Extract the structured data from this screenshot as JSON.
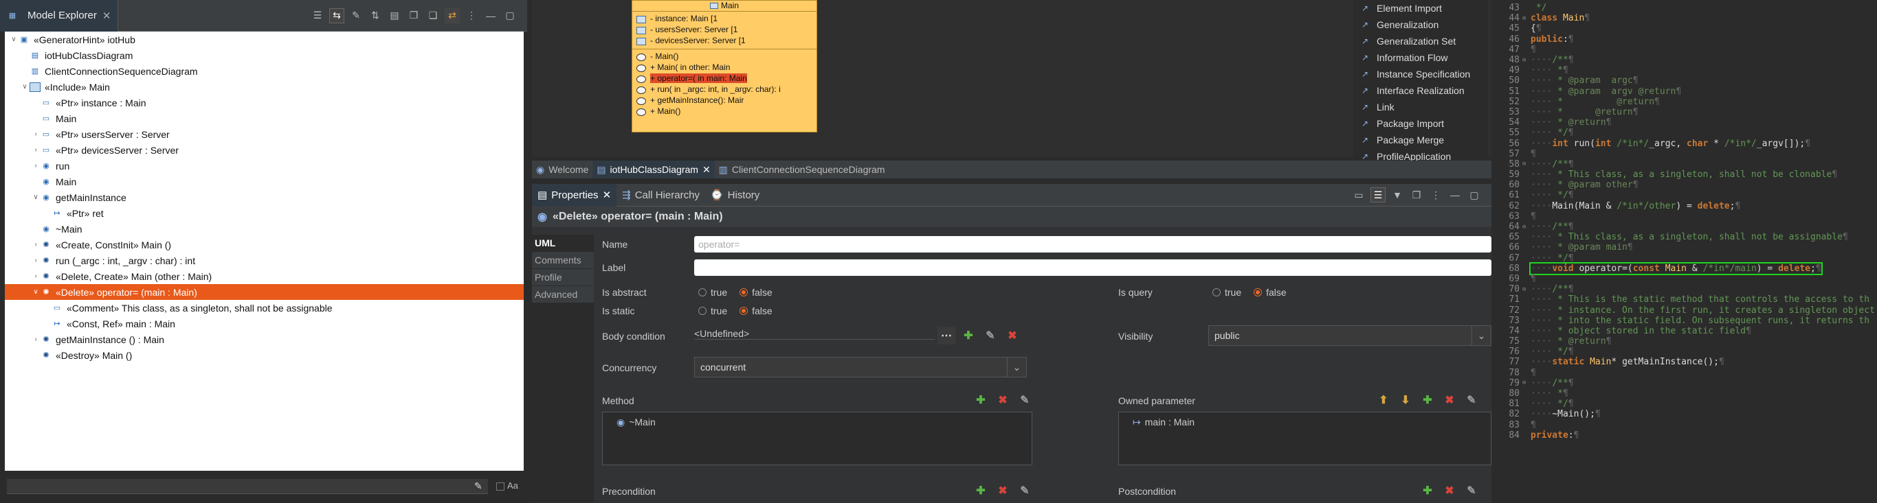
{
  "explorer": {
    "title": "Model Explorer",
    "aa": "Aa",
    "items": [
      {
        "label": "«GeneratorHint» iotHub",
        "indent": 0,
        "tw": "∨",
        "icon": "pkg"
      },
      {
        "label": "iotHubClassDiagram",
        "indent": 1,
        "tw": "",
        "icon": "diag"
      },
      {
        "label": "ClientConnectionSequenceDiagram",
        "indent": 1,
        "tw": "",
        "icon": "seq"
      },
      {
        "label": "«Include» Main",
        "indent": 1,
        "tw": "∨",
        "icon": "cls"
      },
      {
        "label": "«Ptr» instance : Main",
        "indent": 2,
        "tw": "",
        "icon": "attr"
      },
      {
        "label": "Main",
        "indent": 2,
        "tw": "",
        "icon": "attr"
      },
      {
        "label": "«Ptr» usersServer : Server",
        "indent": 2,
        "tw": "›",
        "icon": "attr"
      },
      {
        "label": "«Ptr» devicesServer : Server",
        "indent": 2,
        "tw": "›",
        "icon": "attr"
      },
      {
        "label": "run",
        "indent": 2,
        "tw": "›",
        "icon": "op"
      },
      {
        "label": "Main",
        "indent": 2,
        "tw": "",
        "icon": "op"
      },
      {
        "label": "getMainInstance",
        "indent": 2,
        "tw": "∨",
        "icon": "op"
      },
      {
        "label": "«Ptr» ret",
        "indent": 3,
        "tw": "",
        "icon": "param"
      },
      {
        "label": "~Main",
        "indent": 2,
        "tw": "",
        "icon": "op"
      },
      {
        "label": "«Create, ConstInit» Main ()",
        "indent": 2,
        "tw": "›",
        "icon": "gear"
      },
      {
        "label": "run (_argc : int, _argv : char) : int",
        "indent": 2,
        "tw": "›",
        "icon": "gear"
      },
      {
        "label": "«Delete, Create» Main (other : Main)",
        "indent": 2,
        "tw": "›",
        "icon": "gear"
      },
      {
        "label": "«Delete» operator= (main : Main)",
        "indent": 2,
        "tw": "∨",
        "icon": "gear",
        "selected": true
      },
      {
        "label": "«Comment» This class, as a singleton, shall not be assignable",
        "indent": 3,
        "tw": "",
        "icon": "note"
      },
      {
        "label": "«Const, Ref» main : Main",
        "indent": 3,
        "tw": "",
        "icon": "param"
      },
      {
        "label": "getMainInstance () : Main",
        "indent": 2,
        "tw": "›",
        "icon": "gear"
      },
      {
        "label": "«Destroy» Main ()",
        "indent": 2,
        "tw": "",
        "icon": "gear"
      }
    ]
  },
  "uml": {
    "title": "Main",
    "attrs": [
      "- instance: Main [1",
      "- usersServer: Server [1",
      "- devicesServer: Server [1"
    ],
    "ops": [
      "- Main()",
      "+ Main(  in other: Main",
      "+ operator=(  in main: Main",
      "+ run(  in _argc: int,  in _argv: char): i",
      "+ getMainInstance(): Mair",
      "+ Main()"
    ]
  },
  "palette": [
    "Element Import",
    "Generalization",
    "Generalization Set",
    "Information Flow",
    "Instance Specification",
    "Interface Realization",
    "Link",
    "Package Import",
    "Package Merge",
    "ProfileApplication"
  ],
  "editor_tabs": [
    "Welcome",
    "iotHubClassDiagram",
    "ClientConnectionSequenceDiagram"
  ],
  "props": {
    "tabs": [
      "Properties",
      "Call Hierarchy",
      "History"
    ],
    "title": "«Delete» operator= (main : Main)",
    "vtabs": [
      "UML",
      "Comments",
      "Profile",
      "Advanced"
    ],
    "name_label": "Name",
    "name_placeholder": "operator=",
    "label_label": "Label",
    "is_abstract": "Is abstract",
    "is_static": "Is static",
    "is_query": "Is query",
    "true": "true",
    "false": "false",
    "body_condition": "Body condition",
    "body_value": "<Undefined>",
    "visibility": "Visibility",
    "visibility_value": "public",
    "concurrency": "Concurrency",
    "concurrency_value": "concurrent",
    "method": "Method",
    "method_item": "~Main",
    "owned_parameter": "Owned parameter",
    "param_item": "main : Main",
    "precondition": "Precondition",
    "postcondition": "Postcondition"
  },
  "code": {
    "lines": [
      {
        "n": "43",
        "m": "",
        "t": [
          {
            "c": "cm",
            "s": " */"
          }
        ]
      },
      {
        "n": "44",
        "m": "⊖",
        "t": [
          {
            "c": "kw",
            "s": "class "
          },
          {
            "c": "fn",
            "s": "Main"
          },
          {
            "c": "gray",
            "s": "¶"
          }
        ]
      },
      {
        "n": "45",
        "m": "",
        "t": [
          {
            "c": "code",
            "s": "{"
          },
          {
            "c": "gray",
            "s": "¶"
          }
        ]
      },
      {
        "n": "46",
        "m": "",
        "t": [
          {
            "c": "kw",
            "s": "public"
          },
          {
            "c": "code",
            "s": ":"
          },
          {
            "c": "gray",
            "s": "¶"
          }
        ]
      },
      {
        "n": "47",
        "m": "",
        "t": [
          {
            "c": "gray",
            "s": "¶"
          }
        ]
      },
      {
        "n": "48",
        "m": "⊖",
        "t": [
          {
            "c": "gray",
            "s": "····"
          },
          {
            "c": "cm",
            "s": "/**"
          },
          {
            "c": "gray",
            "s": "¶"
          }
        ]
      },
      {
        "n": "49",
        "m": "",
        "t": [
          {
            "c": "gray",
            "s": "····"
          },
          {
            "c": "cm",
            "s": " *"
          },
          {
            "c": "gray",
            "s": "¶"
          }
        ]
      },
      {
        "n": "50",
        "m": "",
        "t": [
          {
            "c": "gray",
            "s": "····"
          },
          {
            "c": "cm",
            "s": " * "
          },
          {
            "c": "jd",
            "s": "@param  argc"
          },
          {
            "c": "gray",
            "s": "¶"
          }
        ]
      },
      {
        "n": "51",
        "m": "",
        "t": [
          {
            "c": "gray",
            "s": "····"
          },
          {
            "c": "cm",
            "s": " * "
          },
          {
            "c": "jd",
            "s": "@param  argv @return"
          },
          {
            "c": "gray",
            "s": "¶"
          }
        ]
      },
      {
        "n": "52",
        "m": "",
        "t": [
          {
            "c": "gray",
            "s": "····"
          },
          {
            "c": "cm",
            "s": " *          "
          },
          {
            "c": "jd",
            "s": "@return"
          },
          {
            "c": "gray",
            "s": "¶"
          }
        ]
      },
      {
        "n": "53",
        "m": "",
        "t": [
          {
            "c": "gray",
            "s": "····"
          },
          {
            "c": "cm",
            "s": " *      "
          },
          {
            "c": "jd",
            "s": "@return"
          },
          {
            "c": "gray",
            "s": "¶"
          }
        ]
      },
      {
        "n": "54",
        "m": "",
        "t": [
          {
            "c": "gray",
            "s": "····"
          },
          {
            "c": "cm",
            "s": " * "
          },
          {
            "c": "jd",
            "s": "@return"
          },
          {
            "c": "gray",
            "s": "¶"
          }
        ]
      },
      {
        "n": "55",
        "m": "",
        "t": [
          {
            "c": "gray",
            "s": "····"
          },
          {
            "c": "cm",
            "s": " */"
          },
          {
            "c": "gray",
            "s": "¶"
          }
        ]
      },
      {
        "n": "56",
        "m": "",
        "t": [
          {
            "c": "gray",
            "s": "····"
          },
          {
            "c": "kw",
            "s": "int "
          },
          {
            "c": "code",
            "s": "run("
          },
          {
            "c": "kw",
            "s": "int "
          },
          {
            "c": "cm",
            "s": "/*in*/"
          },
          {
            "c": "code",
            "s": "_argc, "
          },
          {
            "c": "kw",
            "s": "char "
          },
          {
            "c": "code",
            "s": "* "
          },
          {
            "c": "cm",
            "s": "/*in*/"
          },
          {
            "c": "code",
            "s": "_argv[]);"
          },
          {
            "c": "gray",
            "s": "¶"
          }
        ]
      },
      {
        "n": "57",
        "m": "",
        "t": [
          {
            "c": "gray",
            "s": "¶"
          }
        ]
      },
      {
        "n": "58",
        "m": "⊖",
        "t": [
          {
            "c": "gray",
            "s": "····"
          },
          {
            "c": "cm",
            "s": "/**"
          },
          {
            "c": "gray",
            "s": "¶"
          }
        ]
      },
      {
        "n": "59",
        "m": "",
        "t": [
          {
            "c": "gray",
            "s": "····"
          },
          {
            "c": "cm",
            "s": " * This class, as a singleton, shall not be clonable"
          },
          {
            "c": "gray",
            "s": "¶"
          }
        ]
      },
      {
        "n": "60",
        "m": "",
        "t": [
          {
            "c": "gray",
            "s": "····"
          },
          {
            "c": "cm",
            "s": " * "
          },
          {
            "c": "jd",
            "s": "@param other"
          },
          {
            "c": "gray",
            "s": "¶"
          }
        ]
      },
      {
        "n": "61",
        "m": "",
        "t": [
          {
            "c": "gray",
            "s": "····"
          },
          {
            "c": "cm",
            "s": " */"
          },
          {
            "c": "gray",
            "s": "¶"
          }
        ]
      },
      {
        "n": "62",
        "m": "",
        "t": [
          {
            "c": "gray",
            "s": "····"
          },
          {
            "c": "code",
            "s": "Main(Main & "
          },
          {
            "c": "cm",
            "s": "/*in*/other"
          },
          {
            "c": "code",
            "s": ") = "
          },
          {
            "c": "kw",
            "s": "delete"
          },
          {
            "c": "code",
            "s": ";"
          },
          {
            "c": "gray",
            "s": "¶"
          }
        ]
      },
      {
        "n": "63",
        "m": "",
        "t": [
          {
            "c": "gray",
            "s": "¶"
          }
        ]
      },
      {
        "n": "64",
        "m": "⊖",
        "t": [
          {
            "c": "gray",
            "s": "····"
          },
          {
            "c": "cm",
            "s": "/**"
          },
          {
            "c": "gray",
            "s": "¶"
          }
        ]
      },
      {
        "n": "65",
        "m": "",
        "t": [
          {
            "c": "gray",
            "s": "····"
          },
          {
            "c": "cm",
            "s": " * This class, as a singleton, shall not be assignable"
          },
          {
            "c": "gray",
            "s": "¶"
          }
        ]
      },
      {
        "n": "66",
        "m": "",
        "t": [
          {
            "c": "gray",
            "s": "····"
          },
          {
            "c": "cm",
            "s": " * "
          },
          {
            "c": "jd",
            "s": "@param main"
          },
          {
            "c": "gray",
            "s": "¶"
          }
        ]
      },
      {
        "n": "67",
        "m": "",
        "t": [
          {
            "c": "gray",
            "s": "····"
          },
          {
            "c": "cm",
            "s": " */"
          },
          {
            "c": "gray",
            "s": "¶"
          }
        ]
      },
      {
        "n": "68",
        "m": "",
        "box": true,
        "t": [
          {
            "c": "gray",
            "s": "····"
          },
          {
            "c": "kw",
            "s": "void "
          },
          {
            "c": "code",
            "s": "operator=("
          },
          {
            "c": "kw",
            "s": "const "
          },
          {
            "c": "fn",
            "s": "Main"
          },
          {
            "c": "code",
            "s": " & "
          },
          {
            "c": "cm",
            "s": "/*in*/main"
          },
          {
            "c": "code",
            "s": ") = "
          },
          {
            "c": "kw",
            "s": "delete"
          },
          {
            "c": "code",
            "s": ";"
          },
          {
            "c": "gray",
            "s": "¶"
          }
        ]
      },
      {
        "n": "69",
        "m": "",
        "t": [
          {
            "c": "gray",
            "s": "¶"
          }
        ]
      },
      {
        "n": "70",
        "m": "⊖",
        "t": [
          {
            "c": "gray",
            "s": "····"
          },
          {
            "c": "cm",
            "s": "/**"
          },
          {
            "c": "gray",
            "s": "¶"
          }
        ]
      },
      {
        "n": "71",
        "m": "",
        "t": [
          {
            "c": "gray",
            "s": "····"
          },
          {
            "c": "cm",
            "s": " * This is the static method that controls the access to th"
          }
        ]
      },
      {
        "n": "72",
        "m": "",
        "t": [
          {
            "c": "gray",
            "s": "····"
          },
          {
            "c": "cm",
            "s": " * instance. On the first run, it creates a singleton object"
          }
        ]
      },
      {
        "n": "73",
        "m": "",
        "t": [
          {
            "c": "gray",
            "s": "····"
          },
          {
            "c": "cm",
            "s": " * into the static field. On subsequent runs, it returns th"
          }
        ]
      },
      {
        "n": "74",
        "m": "",
        "t": [
          {
            "c": "gray",
            "s": "····"
          },
          {
            "c": "cm",
            "s": " * object stored in the static field"
          },
          {
            "c": "gray",
            "s": "¶"
          }
        ]
      },
      {
        "n": "75",
        "m": "",
        "t": [
          {
            "c": "gray",
            "s": "····"
          },
          {
            "c": "cm",
            "s": " * "
          },
          {
            "c": "jd",
            "s": "@return"
          },
          {
            "c": "gray",
            "s": "¶"
          }
        ]
      },
      {
        "n": "76",
        "m": "",
        "t": [
          {
            "c": "gray",
            "s": "····"
          },
          {
            "c": "cm",
            "s": " */"
          },
          {
            "c": "gray",
            "s": "¶"
          }
        ]
      },
      {
        "n": "77",
        "m": "",
        "t": [
          {
            "c": "gray",
            "s": "····"
          },
          {
            "c": "kw",
            "s": "static "
          },
          {
            "c": "fn",
            "s": "Main"
          },
          {
            "c": "code",
            "s": "* getMainInstance();"
          },
          {
            "c": "gray",
            "s": "¶"
          }
        ]
      },
      {
        "n": "78",
        "m": "",
        "t": [
          {
            "c": "gray",
            "s": "¶"
          }
        ]
      },
      {
        "n": "79",
        "m": "⊖",
        "t": [
          {
            "c": "gray",
            "s": "····"
          },
          {
            "c": "cm",
            "s": "/**"
          },
          {
            "c": "gray",
            "s": "¶"
          }
        ]
      },
      {
        "n": "80",
        "m": "",
        "t": [
          {
            "c": "gray",
            "s": "····"
          },
          {
            "c": "cm",
            "s": " *"
          },
          {
            "c": "gray",
            "s": "¶"
          }
        ]
      },
      {
        "n": "81",
        "m": "",
        "t": [
          {
            "c": "gray",
            "s": "····"
          },
          {
            "c": "cm",
            "s": " */"
          },
          {
            "c": "gray",
            "s": "¶"
          }
        ]
      },
      {
        "n": "82",
        "m": "",
        "t": [
          {
            "c": "gray",
            "s": "····"
          },
          {
            "c": "code",
            "s": "~Main();"
          },
          {
            "c": "gray",
            "s": "¶"
          }
        ]
      },
      {
        "n": "83",
        "m": "",
        "t": [
          {
            "c": "gray",
            "s": "¶"
          }
        ]
      },
      {
        "n": "84",
        "m": "",
        "t": [
          {
            "c": "kw",
            "s": "private"
          },
          {
            "c": "code",
            "s": ":"
          },
          {
            "c": "gray",
            "s": "¶"
          }
        ]
      }
    ]
  }
}
